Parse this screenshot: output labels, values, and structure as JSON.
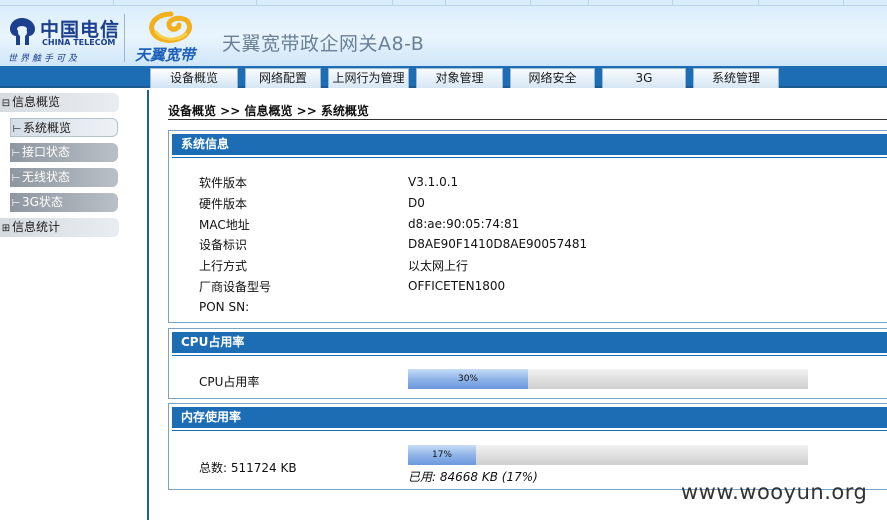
{
  "header": {
    "brand_cn": "中国电信",
    "brand_en": "CHINA TELECOM",
    "slogan": "世界触手可及",
    "product_brand": "天翼宽带",
    "product_title": "天翼宽带政企网关A8-B"
  },
  "nav": {
    "tabs": [
      {
        "label": "设备概览",
        "active": true
      },
      {
        "label": "网络配置",
        "active": false
      },
      {
        "label": "上网行为管理",
        "active": false
      },
      {
        "label": "对象管理",
        "active": false
      },
      {
        "label": "网络安全",
        "active": false
      },
      {
        "label": "3G",
        "active": false
      },
      {
        "label": "系统管理",
        "active": false
      }
    ]
  },
  "sidebar": {
    "items": [
      {
        "prefix": "⊟",
        "label": "信息概览",
        "type": "group"
      },
      {
        "prefix": "⊢",
        "label": "系统概览",
        "type": "child",
        "active": true
      },
      {
        "prefix": "⊢",
        "label": "接口状态",
        "type": "child",
        "active": false
      },
      {
        "prefix": "⊢",
        "label": "无线状态",
        "type": "child",
        "active": false
      },
      {
        "prefix": "⊢",
        "label": "3G状态",
        "type": "child",
        "active": false
      },
      {
        "prefix": "⊞",
        "label": "信息统计",
        "type": "group"
      }
    ]
  },
  "breadcrumb": "设备概览 >> 信息概览 >> 系统概览",
  "system_info": {
    "title": "系统信息",
    "rows": [
      {
        "label": "软件版本",
        "value": "V3.1.0.1"
      },
      {
        "label": "硬件版本",
        "value": "D0"
      },
      {
        "label": "MAC地址",
        "value": "d8:ae:90:05:74:81"
      },
      {
        "label": "设备标识",
        "value": "D8AE90F1410D8AE90057481"
      },
      {
        "label": "上行方式",
        "value": "以太网上行"
      },
      {
        "label": "厂商设备型号",
        "value": "OFFICETEN1800"
      },
      {
        "label": "PON SN:",
        "value": ""
      }
    ]
  },
  "cpu": {
    "title": "CPU占用率",
    "label": "CPU占用率",
    "percent": 30,
    "percent_text": "30%"
  },
  "memory": {
    "title": "内存使用率",
    "total_label": "总数: 511724 KB",
    "percent": 17,
    "percent_text": "17%",
    "used_note": "已用: 84668 KB (17%)"
  },
  "watermark": "www.wooyun.org",
  "colors": {
    "nav_blue": "#1c6db3",
    "bar_fill": "#8fb4e8",
    "brand_blue": "#1c3f8e"
  }
}
